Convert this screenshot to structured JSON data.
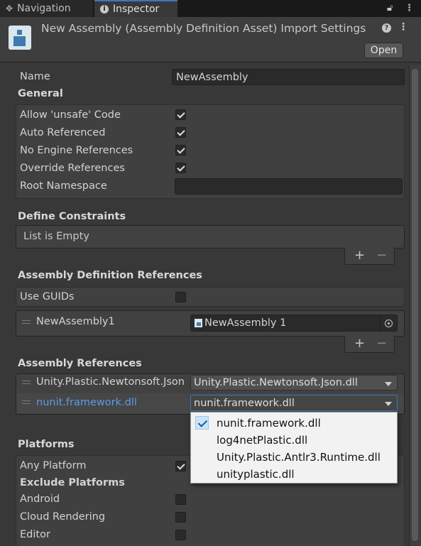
{
  "tabs": [
    {
      "label": "Navigation"
    },
    {
      "label": "Inspector"
    }
  ],
  "header": {
    "title": "New Assembly (Assembly Definition Asset) Import Settings",
    "open_label": "Open"
  },
  "name": {
    "label": "Name",
    "value": "NewAssembly"
  },
  "general": {
    "title": "General",
    "items": [
      {
        "label": "Allow 'unsafe' Code",
        "checked": true
      },
      {
        "label": "Auto Referenced",
        "checked": true
      },
      {
        "label": "No Engine References",
        "checked": true
      },
      {
        "label": "Override References",
        "checked": true
      }
    ],
    "root_namespace": {
      "label": "Root Namespace",
      "value": ""
    }
  },
  "define_constraints": {
    "title": "Define Constraints",
    "empty_text": "List is Empty",
    "plus": "+",
    "minus": "−"
  },
  "asmdef_refs": {
    "title": "Assembly Definition References",
    "use_guids": {
      "label": "Use GUIDs",
      "checked": false
    },
    "items": [
      {
        "label": "NewAssembly1",
        "value": "NewAssembly 1"
      }
    ],
    "plus": "+",
    "minus": "−"
  },
  "assembly_refs": {
    "title": "Assembly References",
    "items": [
      {
        "label": "Unity.Plastic.Newtonsoft.Json",
        "value": "Unity.Plastic.Newtonsoft.Json.dll"
      },
      {
        "label": "nunit.framework.dll",
        "value": "nunit.framework.dll"
      }
    ]
  },
  "dropdown_popup": {
    "options": [
      {
        "label": "nunit.framework.dll",
        "selected": true
      },
      {
        "label": "log4netPlastic.dll",
        "selected": false
      },
      {
        "label": "Unity.Plastic.Antlr3.Runtime.dll",
        "selected": false
      },
      {
        "label": "unityplastic.dll",
        "selected": false
      }
    ]
  },
  "platforms": {
    "title": "Platforms",
    "any_platform": {
      "label": "Any Platform",
      "checked": true
    },
    "exclude_title": "Exclude Platforms",
    "exclude": [
      {
        "label": "Android",
        "checked": false
      },
      {
        "label": "Cloud Rendering",
        "checked": false
      },
      {
        "label": "Editor",
        "checked": false
      }
    ]
  },
  "colors": {
    "accent_tab": "#3a79bb",
    "selected_ref": "#5b9be6",
    "background": "#383838"
  }
}
